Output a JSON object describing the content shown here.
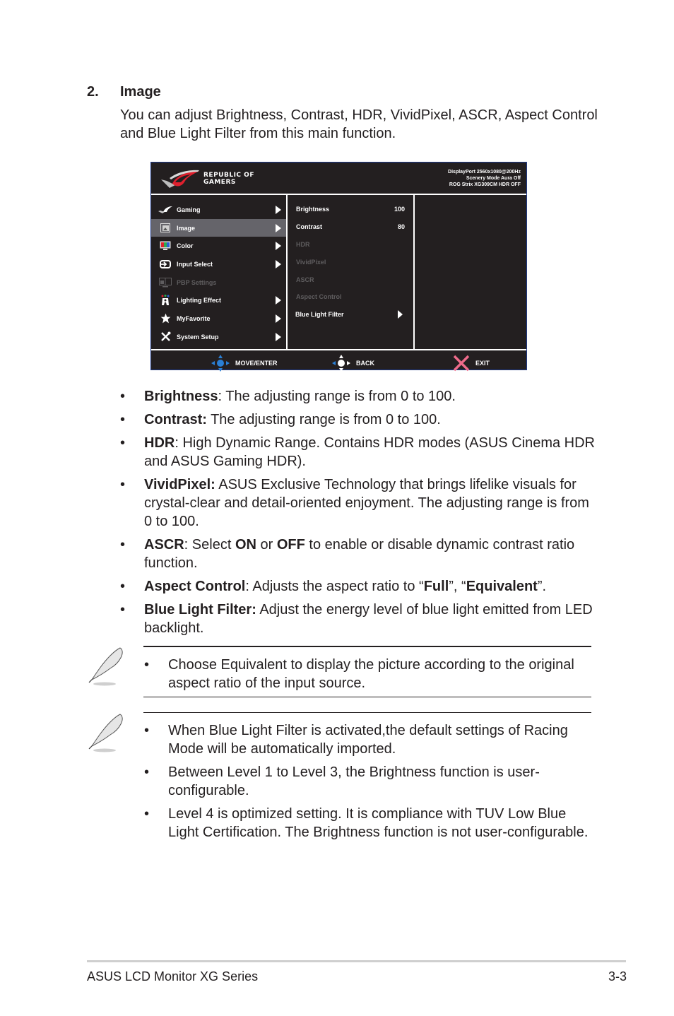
{
  "section": {
    "number": "2.",
    "title": "Image",
    "intro": "You can adjust Brightness, Contrast, HDR, VividPixel, ASCR, Aspect Control and Blue Light Filter from this main function."
  },
  "osd": {
    "brand_line1": "REPUBLIC OF",
    "brand_line2": "GAMERS",
    "info_line1": "DisplayPort 2560x1080@200Hz",
    "info_line2": "Scenery Mode Aura Off",
    "info_line3": "ROG Strix XG309CM HDR OFF",
    "menu": [
      {
        "label": "Gaming",
        "icon": "rog-eye-icon",
        "state": "normal"
      },
      {
        "label": "Image",
        "icon": "image-icon",
        "state": "selected"
      },
      {
        "label": "Color",
        "icon": "color-monitor-icon",
        "state": "normal"
      },
      {
        "label": "Input Select",
        "icon": "input-icon",
        "state": "normal"
      },
      {
        "label": "PBP Settings",
        "icon": "pbp-icon",
        "state": "disabled"
      },
      {
        "label": "Lighting Effect",
        "icon": "lighting-icon",
        "state": "normal"
      },
      {
        "label": "MyFavorite",
        "icon": "star-icon",
        "state": "normal"
      },
      {
        "label": "System Setup",
        "icon": "tools-icon",
        "state": "normal"
      }
    ],
    "submenu": [
      {
        "label": "Brightness",
        "value": "100",
        "state": "normal"
      },
      {
        "label": "Contrast",
        "value": "80",
        "state": "normal"
      },
      {
        "label": "HDR",
        "value": "",
        "state": "disabled"
      },
      {
        "label": "VividPixel",
        "value": "",
        "state": "disabled"
      },
      {
        "label": "ASCR",
        "value": "",
        "state": "disabled"
      },
      {
        "label": "Aspect Control",
        "value": "",
        "state": "disabled"
      },
      {
        "label": "Blue Light Filter",
        "value": "",
        "state": "submenu"
      }
    ],
    "footer": {
      "move_enter": "MOVE/ENTER",
      "back": "BACK",
      "exit": "EXIT"
    },
    "colors": {
      "background": "#231f20",
      "selected": "#65646a",
      "disabled_text": "#5f5d5f",
      "nav_blue": "#2a7fd4",
      "exit_pink": "#ef6b8a",
      "rog_red": "#e0202e"
    }
  },
  "bullets": [
    {
      "term": "Brightness",
      "sep": ": ",
      "text": "The adjusting range is from 0 to 100."
    },
    {
      "term": "Contrast:",
      "sep": " ",
      "text": "The adjusting range is from 0 to 100."
    },
    {
      "term": "HDR",
      "sep": ": ",
      "text": "High Dynamic Range. Contains HDR modes (ASUS Cinema HDR and ASUS Gaming HDR)."
    },
    {
      "term": "VividPixel:",
      "sep": " ",
      "text": "ASUS Exclusive Technology that brings lifelike visuals for crystal-clear and detail-oriented enjoyment. The adjusting range is from 0 to 100."
    },
    {
      "term": "ASCR",
      "parts": [
        ": Select ",
        "ON",
        " or ",
        "OFF",
        " to enable or disable dynamic contrast ratio function."
      ]
    },
    {
      "term": "Aspect Control",
      "parts": [
        ": Adjusts the aspect ratio to “",
        "Full",
        "”, “",
        "Equivalent",
        "”."
      ]
    },
    {
      "term": "Blue Light Filter:",
      "sep": " ",
      "text": "Adjust the energy level of blue light emitted from LED backlight."
    }
  ],
  "notes": [
    {
      "items": [
        "Choose Equivalent to display the picture according to the original aspect ratio of the input source."
      ]
    },
    {
      "items": [
        "When Blue Light Filter is activated,the default settings of Racing Mode will be automatically imported.",
        "Between Level 1 to Level 3, the Brightness function is user-configurable.",
        "Level 4 is optimized setting. It is compliance with TUV Low Blue Light Certification. The Brightness function is not user-configurable."
      ]
    }
  ],
  "footer": {
    "left": "ASUS LCD Monitor XG Series",
    "right": "3-3"
  }
}
